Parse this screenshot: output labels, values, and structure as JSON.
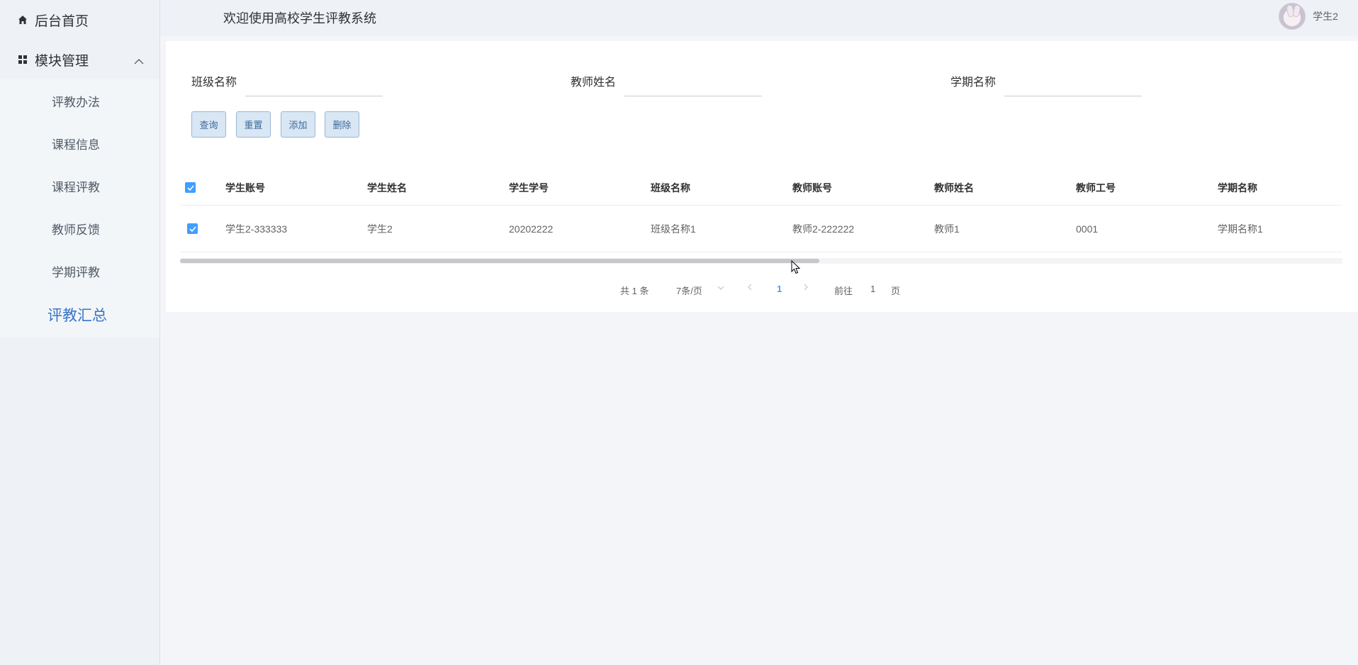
{
  "sidebar": {
    "home_label": "后台首页",
    "group_label": "模块管理",
    "items": [
      {
        "label": "评教办法"
      },
      {
        "label": "课程信息"
      },
      {
        "label": "课程评教"
      },
      {
        "label": "教师反馈"
      },
      {
        "label": "学期评教"
      },
      {
        "label": "评教汇总",
        "active": true
      }
    ]
  },
  "header": {
    "welcome": "欢迎使用高校学生评教系统",
    "username": "学生2"
  },
  "search": {
    "class_label": "班级名称",
    "class_value": "",
    "teacher_label": "教师姓名",
    "teacher_value": "",
    "term_label": "学期名称",
    "term_value": ""
  },
  "buttons": {
    "query": "查询",
    "reset": "重置",
    "add": "添加",
    "delete": "删除"
  },
  "table": {
    "columns": [
      "学生账号",
      "学生姓名",
      "学生学号",
      "班级名称",
      "教师账号",
      "教师姓名",
      "教师工号",
      "学期名称"
    ],
    "rows": [
      {
        "checked": true,
        "cells": [
          "学生2-333333",
          "学生2",
          "20202222",
          "班级名称1",
          "教师2-222222",
          "教师1",
          "0001",
          "学期名称1"
        ]
      }
    ],
    "select_all_checked": true
  },
  "pagination": {
    "total": "共 1 条",
    "page_size": "7条/页",
    "current_page": "1",
    "goto_label": "前往",
    "goto_value": "1",
    "page_suffix": "页"
  },
  "colors": {
    "accent": "#409eff",
    "active_menu": "#3875c7",
    "sidebar_bg": "#eef1f6"
  }
}
